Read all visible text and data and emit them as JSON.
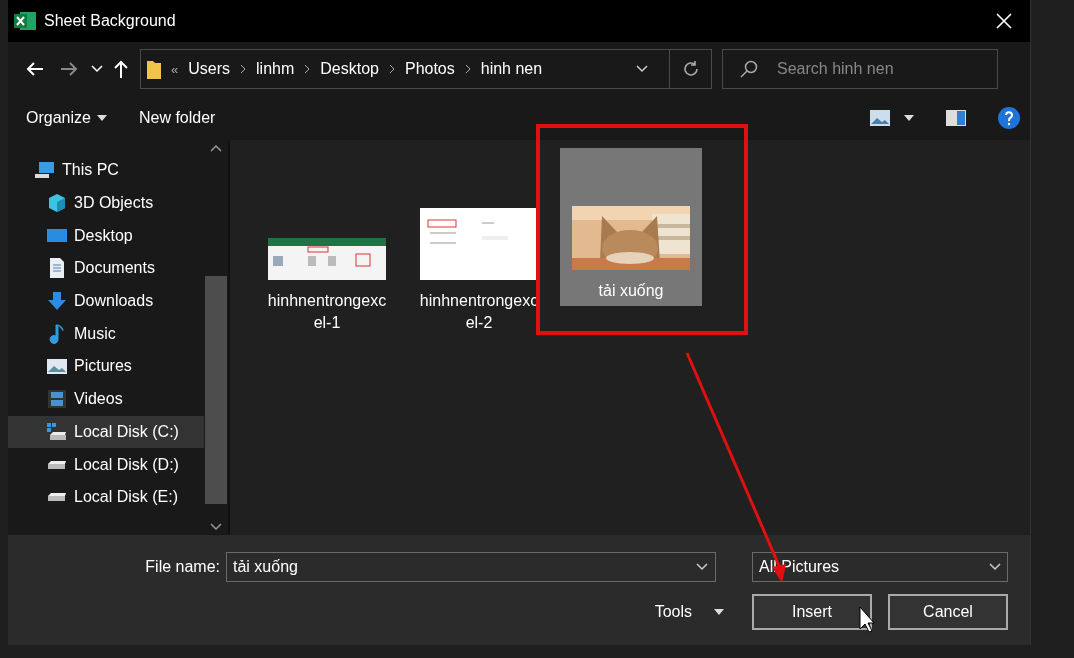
{
  "window": {
    "title": "Sheet Background"
  },
  "address": {
    "overflow": "«",
    "crumbs": [
      "Users",
      "linhm",
      "Desktop",
      "Photos",
      "hinh nen"
    ],
    "search_placeholder": "Search hinh nen"
  },
  "toolbar": {
    "organize": "Organize",
    "new_folder": "New folder"
  },
  "sidebar": {
    "items": [
      {
        "label": "This PC",
        "kind": "pc",
        "selected": false,
        "children": [
          {
            "label": "3D Objects",
            "kind": "cube",
            "selected": false
          },
          {
            "label": "Desktop",
            "kind": "desktop",
            "selected": false
          },
          {
            "label": "Documents",
            "kind": "document",
            "selected": false
          },
          {
            "label": "Downloads",
            "kind": "download",
            "selected": false
          },
          {
            "label": "Music",
            "kind": "music",
            "selected": false
          },
          {
            "label": "Pictures",
            "kind": "pictures",
            "selected": false
          },
          {
            "label": "Videos",
            "kind": "video",
            "selected": false
          },
          {
            "label": "Local Disk (C:)",
            "kind": "system-disk",
            "selected": true
          },
          {
            "label": "Local Disk (D:)",
            "kind": "disk",
            "selected": false
          },
          {
            "label": "Local Disk (E:)",
            "kind": "disk",
            "selected": false
          }
        ]
      }
    ]
  },
  "files": [
    {
      "name": "hinhnentrongexc el-1",
      "kind": "ribbon",
      "selected": false
    },
    {
      "name": "hinhnentrongexc el-2",
      "kind": "dialog",
      "selected": false
    },
    {
      "name": "tải xuống",
      "kind": "picture",
      "selected": true
    }
  ],
  "footer": {
    "file_name_label": "File name:",
    "file_name": "tải xuống",
    "file_type": "All Pictures",
    "tools": "Tools",
    "buttons": [
      "Insert",
      "Cancel"
    ]
  }
}
